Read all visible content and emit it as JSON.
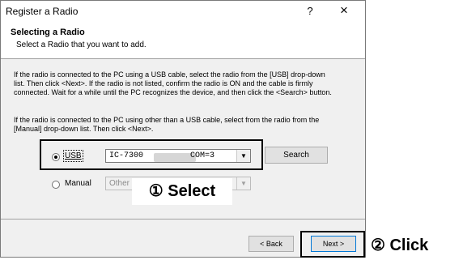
{
  "window": {
    "title": "Register a Radio",
    "help_label": "?",
    "close_label": "×"
  },
  "header": {
    "title": "Selecting a Radio",
    "subtitle": "Select a Radio that you want to add."
  },
  "instructions": {
    "usb": "If the radio is connected to the PC using a USB cable, select the radio from the [USB] drop-down list. Then click <Next>. If the radio is not listed, confirm the radio is ON and the cable is firmly connected. Wait for a while until the PC recognizes the device, and then click the <Search> button.",
    "manual": "If the radio is connected to the PC using other than a USB cable, select from the radio from the [Manual] drop-down list. Then click <Next>."
  },
  "usb_option": {
    "label": "USB",
    "selected": true,
    "model": "IC-7300",
    "port": "COM=3",
    "arrow": "▼"
  },
  "manual_option": {
    "label": "Manual",
    "selected": false,
    "value": "Other",
    "arrow": "▼"
  },
  "search_button": {
    "label": "Search"
  },
  "footer": {
    "back_label": "< Back",
    "next_label": "Next >"
  },
  "callouts": {
    "select": "① Select",
    "click": "② Click"
  }
}
